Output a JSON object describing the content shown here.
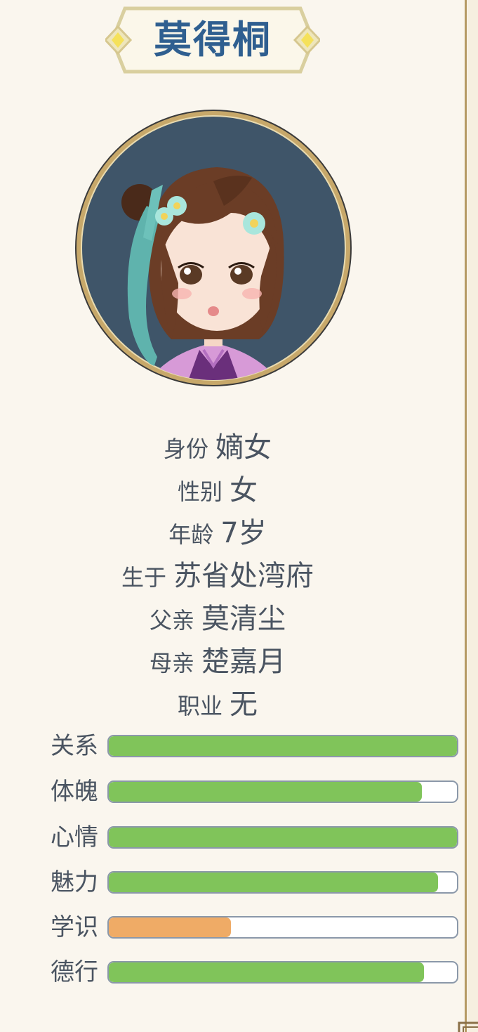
{
  "character": {
    "name": "莫得桐"
  },
  "info": [
    {
      "label": "身份",
      "value": "嫡女"
    },
    {
      "label": "性别",
      "value": "女"
    },
    {
      "label": "年龄",
      "value": "7岁"
    },
    {
      "label": "生于",
      "value": "苏省处湾府"
    },
    {
      "label": "父亲",
      "value": "莫清尘"
    },
    {
      "label": "母亲",
      "value": "楚嘉月"
    },
    {
      "label": "职业",
      "value": "无"
    }
  ],
  "stats": [
    {
      "label": "关系",
      "level": 1.0,
      "color": "#80c45a"
    },
    {
      "label": "体魄",
      "level": 0.9,
      "color": "#80c45a"
    },
    {
      "label": "心情",
      "level": 1.0,
      "color": "#80c45a"
    },
    {
      "label": "魅力",
      "level": 0.945,
      "color": "#80c45a"
    },
    {
      "label": "学识",
      "level": 0.35,
      "color": "#efab66"
    },
    {
      "label": "德行",
      "level": 0.905,
      "color": "#80c45a"
    }
  ],
  "colors": {
    "background": "#faf6ee",
    "title_text": "#2f5f90",
    "bar_border": "#8b98a9",
    "frame_gold": "#d6c78f"
  }
}
